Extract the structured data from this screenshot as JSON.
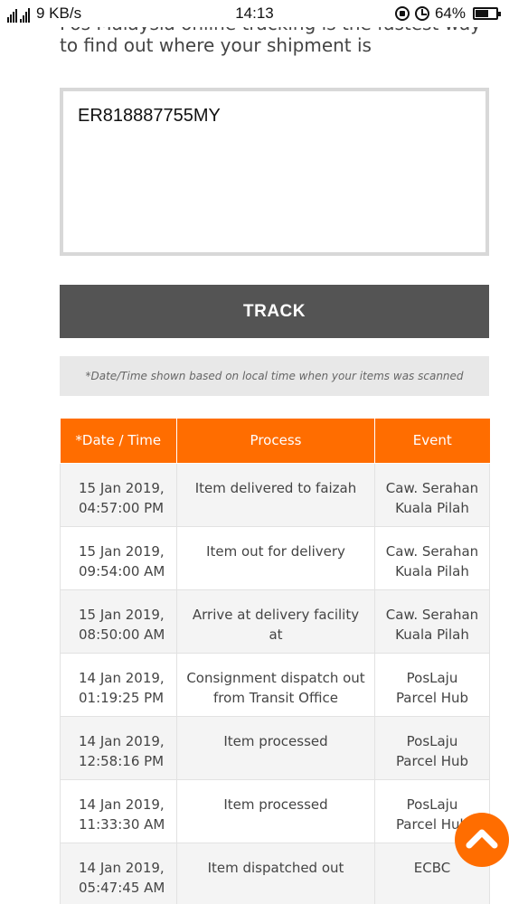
{
  "status_bar": {
    "network_speed": "9 KB/s",
    "time": "14:13",
    "battery_percent": "64%",
    "battery_level": 0.64
  },
  "intro": {
    "text_line1": "Pos Malaysia online tracking is the fastest way",
    "text_line2": "to find out where your shipment is"
  },
  "tracking_input": {
    "value": "ER818887755MY"
  },
  "track_button": {
    "label": "TRACK"
  },
  "note": {
    "text": "*Date/Time shown based on local time when your items was scanned"
  },
  "table": {
    "headers": [
      "*Date / Time",
      "Process",
      "Event"
    ],
    "rows": [
      {
        "date": "15 Jan 2019,",
        "time": "04:57:00 PM",
        "process": "Item delivered to faizah",
        "event_line1": "Caw. Serahan",
        "event_line2": "Kuala Pilah"
      },
      {
        "date": "15 Jan 2019,",
        "time": "09:54:00 AM",
        "process": "Item out for delivery",
        "event_line1": "Caw. Serahan",
        "event_line2": "Kuala Pilah"
      },
      {
        "date": "15 Jan 2019,",
        "time": "08:50:00 AM",
        "process": "Arrive at delivery facility at",
        "event_line1": "Caw. Serahan",
        "event_line2": "Kuala Pilah"
      },
      {
        "date": "14 Jan 2019,",
        "time": "01:19:25 PM",
        "process": "Consignment dispatch out from Transit Office",
        "event_line1": "PosLaju",
        "event_line2": "Parcel Hub"
      },
      {
        "date": "14 Jan 2019,",
        "time": "12:58:16 PM",
        "process": "Item processed",
        "event_line1": "PosLaju",
        "event_line2": "Parcel Hub"
      },
      {
        "date": "14 Jan 2019,",
        "time": "11:33:30 AM",
        "process": "Item processed",
        "event_line1": "PosLaju",
        "event_line2": "Parcel Hub"
      },
      {
        "date": "14 Jan 2019,",
        "time": "05:47:45 AM",
        "process": "Item dispatched out",
        "event_line1": "ECBC",
        "event_line2": ""
      }
    ]
  },
  "colors": {
    "accent": "#ff6d00",
    "button": "#545454"
  },
  "icons": {
    "scroll_top": "chevron-up-icon"
  }
}
